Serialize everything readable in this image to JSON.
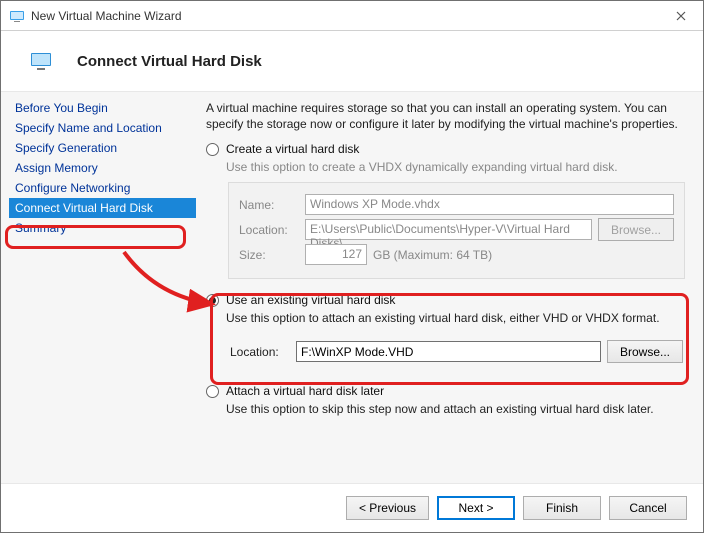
{
  "titlebar": {
    "title": "New Virtual Machine Wizard"
  },
  "header": {
    "title": "Connect Virtual Hard Disk"
  },
  "sidebar": {
    "items": [
      {
        "label": "Before You Begin"
      },
      {
        "label": "Specify Name and Location"
      },
      {
        "label": "Specify Generation"
      },
      {
        "label": "Assign Memory"
      },
      {
        "label": "Configure Networking"
      },
      {
        "label": "Connect Virtual Hard Disk"
      },
      {
        "label": "Summary"
      }
    ]
  },
  "content": {
    "intro": "A virtual machine requires storage so that you can install an operating system. You can specify the storage now or configure it later by modifying the virtual machine's properties.",
    "opt_create": {
      "label": "Create a virtual hard disk",
      "desc": "Use this option to create a VHDX dynamically expanding virtual hard disk.",
      "name_label": "Name:",
      "name_value": "Windows XP Mode.vhdx",
      "loc_label": "Location:",
      "loc_value": "E:\\Users\\Public\\Documents\\Hyper-V\\Virtual Hard Disks\\",
      "browse_label": "Browse...",
      "size_label": "Size:",
      "size_value": "127",
      "size_unit": "GB (Maximum: 64 TB)"
    },
    "opt_existing": {
      "label": "Use an existing virtual hard disk",
      "desc": "Use this option to attach an existing virtual hard disk, either VHD or VHDX format.",
      "loc_label": "Location:",
      "loc_value": "F:\\WinXP Mode.VHD",
      "browse_label": "Browse..."
    },
    "opt_later": {
      "label": "Attach a virtual hard disk later",
      "desc": "Use this option to skip this step now and attach an existing virtual hard disk later."
    }
  },
  "footer": {
    "previous": "< Previous",
    "next": "Next >",
    "finish": "Finish",
    "cancel": "Cancel"
  }
}
